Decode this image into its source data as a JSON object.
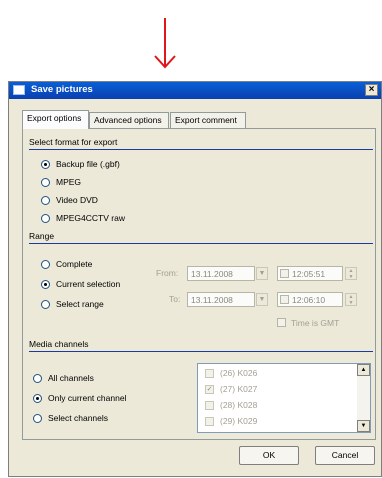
{
  "window": {
    "title": "Save pictures",
    "close_glyph": "×"
  },
  "tabs": [
    {
      "label": "Export options",
      "active": true
    },
    {
      "label": "Advanced options",
      "active": false
    },
    {
      "label": "Export comment",
      "active": false
    }
  ],
  "format": {
    "label": "Select format for export",
    "options": [
      "Backup file (.gbf)",
      "MPEG",
      "Video DVD",
      "MPEG4CCTV raw"
    ],
    "selected": "Backup file (.gbf)"
  },
  "range": {
    "label": "Range",
    "options": [
      "Complete",
      "Current selection",
      "Select range"
    ],
    "selected": "Current selection",
    "from_label": "From:",
    "to_label": "To:",
    "from_date": "13.11.2008",
    "from_time": "12:05:51",
    "to_date": "13.11.2008",
    "to_time": "12:06:10",
    "gmt_label": "Time is GMT"
  },
  "media": {
    "label": "Media channels",
    "options": [
      "All channels",
      "Only current channel",
      "Select channels"
    ],
    "selected": "Only current channel",
    "channels": [
      {
        "label": "(26) K026",
        "checked": false
      },
      {
        "label": "(27) K027",
        "checked": true
      },
      {
        "label": "(28) K028",
        "checked": false
      },
      {
        "label": "(29) K029",
        "checked": false
      }
    ]
  },
  "buttons": {
    "ok": "OK",
    "cancel": "Cancel"
  },
  "colors": {
    "arrow": "#e0171a",
    "titlebar": "#0a4fc4",
    "group_line": "#1d3aa3"
  },
  "icons": {
    "arrow": "down-arrow-icon",
    "close": "close-icon",
    "app": "window-icon"
  }
}
